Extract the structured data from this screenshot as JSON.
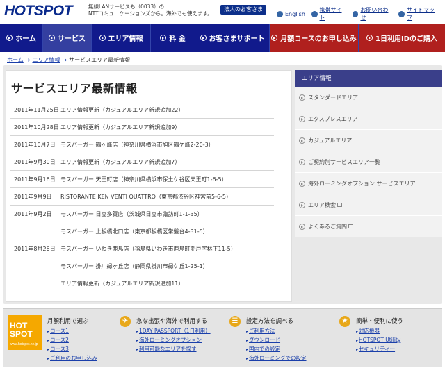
{
  "header": {
    "logo": "HOTSPOT",
    "tagline_1": "無線LANサービスも（0033）の",
    "tagline_2": "NTTコミュニケーションズから。海外でも使えます。",
    "biz_button": "法人のお客さま",
    "links": [
      {
        "label": "English",
        "icon": "globe-icon"
      },
      {
        "label": "携帯サイト",
        "icon": "mobile-icon"
      },
      {
        "label": "お問い合わせ",
        "icon": "mail-icon"
      },
      {
        "label": "サイトマップ",
        "icon": "sitemap-icon"
      }
    ]
  },
  "nav": [
    {
      "label": "ホーム"
    },
    {
      "label": "サービス"
    },
    {
      "label": "エリア情報"
    },
    {
      "label": "料 金"
    },
    {
      "label": "お客さまサポート"
    },
    {
      "label": "月額コースのお申し込み"
    },
    {
      "label": "1日利用IDのご購入"
    }
  ],
  "breadcrumb": {
    "home": "ホーム",
    "area": "エリア情報",
    "current": "サービスエリア最新情報",
    "sep": "➜"
  },
  "main": {
    "title": "サービスエリア最新情報",
    "rows": [
      {
        "date": "2011年11月25日",
        "text": "エリア情報更新（カジュアルエリア新規追加22）"
      },
      {
        "date": "2011年10月28日",
        "text": "エリア情報更新（カジュアルエリア新規追加9）"
      },
      {
        "date": "2011年10月7日",
        "text": "モスバーガー 鶴ヶ峰店（神奈川県横浜市旭区鶴ケ峰2-20-3）"
      },
      {
        "date": "2011年9月30日",
        "text": "エリア情報更新（カジュアルエリア新規追加7）"
      },
      {
        "date": "2011年9月16日",
        "text": "モスバーガー 天王町店（神奈川県横浜市保土ケ谷区天王町1-6-5）"
      },
      {
        "date": "2011年9月9日",
        "text": "RISTORANTE KEN VENTI QUATTRO（東京都渋谷区神宮前5-6-5）"
      },
      {
        "date": "2011年9月2日",
        "text": "モスバーガー 日立多賀店（茨城県日立市諏訪町1-1-35）"
      },
      {
        "date": "",
        "text": "モスバーガー 上板橋北口店（東京都板橋区常盤台4-31-5）"
      },
      {
        "date": "2011年8月26日",
        "text": "モスバーガー いわき鹿島店（福島県いわき市鹿島町船戸字林下11-5）"
      },
      {
        "date": "",
        "text": "モスバーガー 掛川緑ヶ丘店（静岡県掛川市緑ケ丘1-25-1）"
      },
      {
        "date": "",
        "text": "エリア情報更新（カジュアルエリア新規追加11）"
      }
    ]
  },
  "sidebar": {
    "head": "エリア情報",
    "items": [
      {
        "label": "スタンダードエリア"
      },
      {
        "label": "エクスプレスエリア"
      },
      {
        "label": "カジュアルエリア"
      },
      {
        "label": "ご契約別サービスエリア一覧"
      },
      {
        "label": "海外ローミングオプション サービスエリア"
      },
      {
        "label": "エリア検索"
      },
      {
        "label": "よくあるご質問"
      }
    ]
  },
  "footer": [
    {
      "title": "月額利用で選ぶ",
      "logo": "HOT SPOT",
      "logo_sub": "www.hotspot.ne.jp",
      "links": [
        "コース1",
        "コース2",
        "コース3",
        "ご利用のお申し込み"
      ]
    },
    {
      "title": "急な出張や海外で利用する",
      "icon": "airplane-icon",
      "links": [
        "1DAY PASSPORT（1日利用）",
        "海外ローミングオプション",
        "利用可能なエリアを探す"
      ]
    },
    {
      "title": "設定方法を調べる",
      "icon": "document-icon",
      "links": [
        "ご利用方法",
        "ダウンロード",
        "国内での設定",
        "海外ローミングでの設定"
      ]
    },
    {
      "title": "簡単・便利に使う",
      "icon": "star-icon",
      "links": [
        "対応機器",
        "HOTSPOT Utility",
        "セキュリティー"
      ]
    }
  ]
}
